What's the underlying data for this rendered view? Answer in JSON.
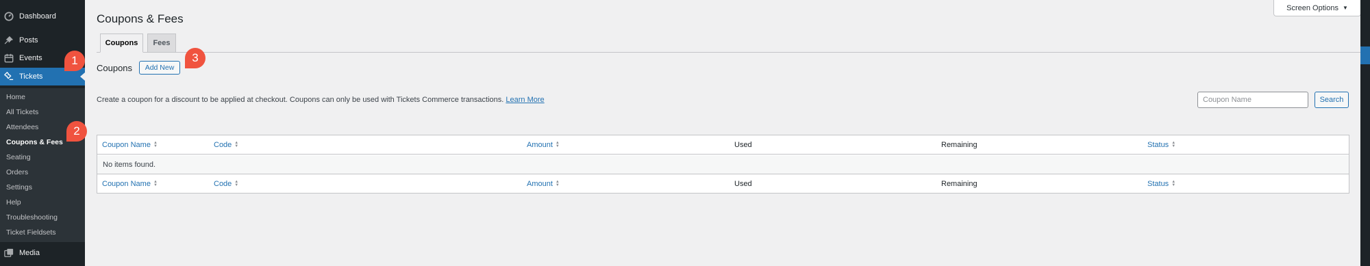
{
  "sidebar": {
    "top_items": [
      {
        "label": "Dashboard",
        "icon": "dashboard-icon"
      },
      {
        "label": "Posts",
        "icon": "pin-icon"
      },
      {
        "label": "Events",
        "icon": "calendar-icon"
      },
      {
        "label": "Tickets",
        "icon": "ticket-icon"
      },
      {
        "label": "Media",
        "icon": "media-icon"
      }
    ],
    "submenu": [
      "Home",
      "All Tickets",
      "Attendees",
      "Coupons & Fees",
      "Seating",
      "Orders",
      "Settings",
      "Help",
      "Troubleshooting",
      "Ticket Fieldsets"
    ]
  },
  "page": {
    "title": "Coupons & Fees",
    "screen_options": "Screen Options",
    "screen_options_arrow": "▼",
    "tabs": [
      "Coupons",
      "Fees"
    ],
    "section_label": "Coupons",
    "add_new": "Add New",
    "description": "Create a coupon for a discount to be applied at checkout. Coupons can only be used with Tickets Commerce transactions.",
    "learn_more": "Learn More",
    "search_placeholder": "Coupon Name",
    "search_button": "Search"
  },
  "table": {
    "columns": [
      "Coupon Name",
      "Code",
      "Amount",
      "Used",
      "Remaining",
      "Status"
    ],
    "empty_message": "No items found."
  },
  "callouts": [
    "1",
    "2",
    "3"
  ],
  "colors": {
    "sidebar_bg": "#1d2327",
    "submenu_bg": "#2c3338",
    "active_blue": "#2271b1",
    "callout": "#f0533f",
    "page_bg": "#f0f0f1"
  }
}
